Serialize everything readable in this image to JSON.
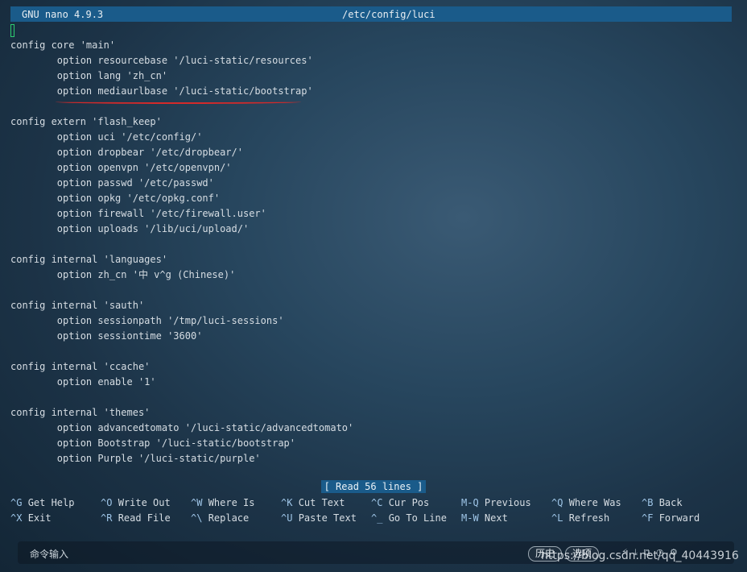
{
  "titlebar": {
    "app": "GNU nano 4.9.3",
    "file": "/etc/config/luci"
  },
  "lines": [
    "",
    "config core 'main'",
    "        option resourcebase '/luci-static/resources'",
    "        option lang 'zh_cn'",
    "        option mediaurlbase '/luci-static/bootstrap'",
    "",
    "config extern 'flash_keep'",
    "        option uci '/etc/config/'",
    "        option dropbear '/etc/dropbear/'",
    "        option openvpn '/etc/openvpn/'",
    "        option passwd '/etc/passwd'",
    "        option opkg '/etc/opkg.conf'",
    "        option firewall '/etc/firewall.user'",
    "        option uploads '/lib/uci/upload/'",
    "",
    "config internal 'languages'",
    "        option zh_cn '中 v^g (Chinese)'",
    "",
    "config internal 'sauth'",
    "        option sessionpath '/tmp/luci-sessions'",
    "        option sessiontime '3600'",
    "",
    "config internal 'ccache'",
    "        option enable '1'",
    "",
    "config internal 'themes'",
    "        option advancedtomato '/luci-static/advancedtomato'",
    "        option Bootstrap '/luci-static/bootstrap'",
    "        option Purple '/luci-static/purple'"
  ],
  "status": "[ Read 56 lines ]",
  "shortcuts_row1": [
    {
      "key": "^G",
      "label": "Get Help"
    },
    {
      "key": "^O",
      "label": "Write Out"
    },
    {
      "key": "^W",
      "label": "Where Is"
    },
    {
      "key": "^K",
      "label": "Cut Text"
    },
    {
      "key": "^C",
      "label": "Cur Pos"
    },
    {
      "key": "M-Q",
      "label": "Previous"
    },
    {
      "key": "^Q",
      "label": "Where Was"
    },
    {
      "key": "^B",
      "label": "Back"
    }
  ],
  "shortcuts_row2": [
    {
      "key": "^X",
      "label": "Exit"
    },
    {
      "key": "^R",
      "label": "Read File"
    },
    {
      "key": "^\\",
      "label": "Replace"
    },
    {
      "key": "^U",
      "label": "Paste Text"
    },
    {
      "key": "^_",
      "label": "Go To Line"
    },
    {
      "key": "M-W",
      "label": "Next"
    },
    {
      "key": "^L",
      "label": "Refresh"
    },
    {
      "key": "^F",
      "label": "Forward"
    }
  ],
  "cmdbar": {
    "label": "命令输入",
    "history_btn": "历史",
    "options_btn": "选项"
  },
  "watermark": "https://blog.csdn.net/qq_40443916",
  "colors": {
    "titlebar": "#1a5b8a",
    "highlight_underline": "#d42a2a",
    "cursor": "#2ecc71"
  }
}
